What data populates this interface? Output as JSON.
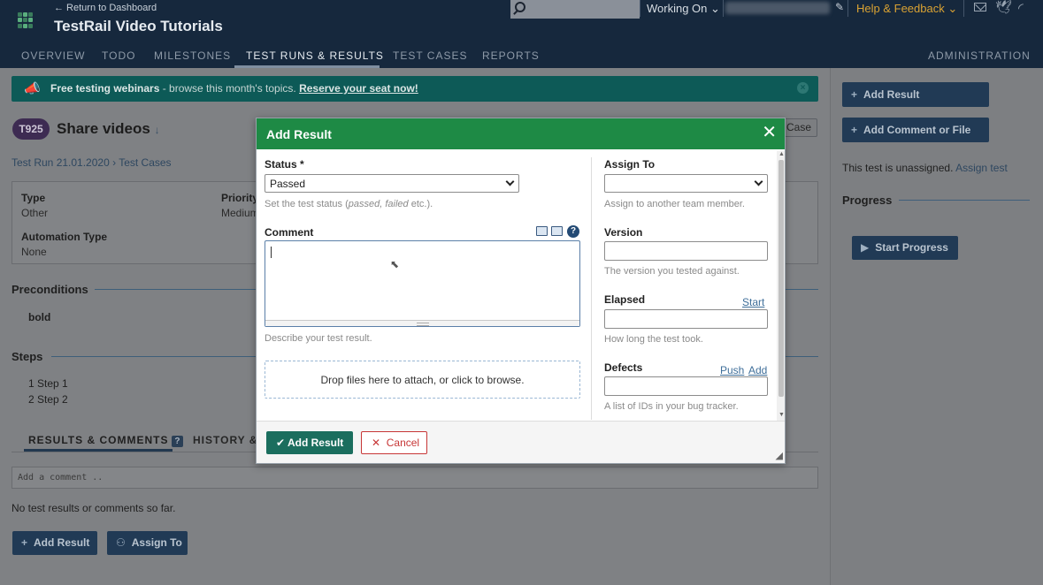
{
  "header": {
    "return_link": "← Return to Dashboard",
    "project_title": "TestRail Video Tutorials",
    "working_on": "Working On",
    "help_feedback": "Help & Feedback"
  },
  "nav": {
    "items": [
      "OVERVIEW",
      "TODO",
      "MILESTONES",
      "TEST RUNS & RESULTS",
      "TEST CASES",
      "REPORTS"
    ],
    "admin": "ADMINISTRATION"
  },
  "banner": {
    "bold": "Free testing webinars",
    "text": " - browse this month's topics. ",
    "link": "Reserve your seat now!"
  },
  "test": {
    "badge": "T925",
    "title": "Share videos",
    "edit_case": "Case",
    "breadcrumb": "Test Run 21.01.2020 › Test Cases"
  },
  "fields": {
    "type_label": "Type",
    "type_value": "Other",
    "priority_label": "Priority",
    "priority_value": "Medium",
    "automation_label": "Automation Type",
    "automation_value": "None"
  },
  "sections": {
    "preconditions": "Preconditions",
    "preconditions_text": "bold",
    "steps": "Steps",
    "step_1": "1 Step 1",
    "step_2": "2 Step 2"
  },
  "tabs": {
    "results": "RESULTS & COMMENTS",
    "results_help": "?",
    "history": "HISTORY & C"
  },
  "comments": {
    "placeholder": "Add a comment ..",
    "empty": "No test results or comments so far.",
    "add_result": "Add Result",
    "assign_to": "Assign To"
  },
  "sidebar": {
    "add_result": "Add Result",
    "add_comment": "Add Comment or File",
    "unassigned": "This test is unassigned. ",
    "assign_link": "Assign test",
    "progress": "Progress",
    "start_progress": "Start Progress"
  },
  "modal": {
    "title": "Add Result",
    "status_label": "Status *",
    "status_value": "Passed",
    "status_hint_1": "Set the test status (",
    "status_hint_2": "passed, failed",
    "status_hint_3": " etc.).",
    "comment_label": "Comment",
    "comment_hint": "Describe your test result.",
    "dropzone": "Drop files here to attach, or click to browse.",
    "assign_label": "Assign To",
    "assign_hint": "Assign to another team member.",
    "version_label": "Version",
    "version_hint": "The version you tested against.",
    "elapsed_label": "Elapsed",
    "elapsed_start": "Start",
    "elapsed_hint": "How long the test took.",
    "defects_label": "Defects",
    "defects_push": "Push",
    "defects_add": "Add",
    "defects_hint": "A list of IDs in your bug tracker.",
    "submit": "Add Result",
    "cancel": "Cancel"
  }
}
